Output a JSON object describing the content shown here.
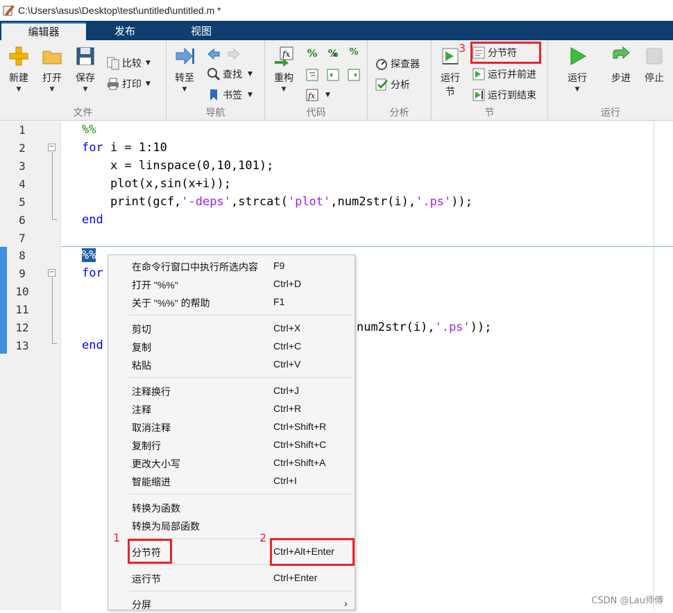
{
  "window": {
    "title": "C:\\Users\\asus\\Desktop\\test\\untitled\\untitled.m *"
  },
  "tabs": [
    {
      "label": "编辑器"
    },
    {
      "label": "发布"
    },
    {
      "label": "视图"
    }
  ],
  "ribbon": {
    "file": {
      "label": "文件",
      "new": "新建",
      "open": "打开",
      "save": "保存",
      "compare": "比较",
      "print": "打印"
    },
    "nav": {
      "label": "导航",
      "goto": "转至",
      "find": "查找",
      "bookmark": "书签"
    },
    "code": {
      "label": "代码",
      "refactor": "重构"
    },
    "analyze": {
      "label": "分析",
      "explorer": "探查器",
      "analyze": "分析"
    },
    "section": {
      "label": "节",
      "run_section_l1": "运行",
      "run_section_l2": "节",
      "section_break": "分节符",
      "run_advance": "运行并前进",
      "run_to_end": "运行到结束"
    },
    "run": {
      "label": "运行",
      "run": "运行",
      "step": "步进",
      "stop": "停止"
    }
  },
  "annotations": {
    "n1": "1",
    "n2": "2",
    "n3": "3"
  },
  "editor": {
    "line_numbers": [
      "1",
      "2",
      "3",
      "4",
      "5",
      "6",
      "7",
      "8",
      "9",
      "10",
      "11",
      "12",
      "13"
    ],
    "code": {
      "l1": "%%",
      "l2_kw": "for",
      "l2": " i = 1:10",
      "l3": "    x = linspace(0,10,101);",
      "l4": "    plot(x,sin(x+i));",
      "l5_a": "    print(gcf,",
      "l5_s1": "'-deps'",
      "l5_b": ",strcat(",
      "l5_s2": "'plot'",
      "l5_c": ",num2str(i),",
      "l5_s3": "'.ps'",
      "l5_d": "));",
      "l6_kw": "end",
      "l8": "%%",
      "l9_kw": "for",
      "l12_c": "num2str(i),",
      "l12_s3": "'.ps'",
      "l12_d": "));",
      "l13_kw": "end"
    }
  },
  "context_menu": {
    "items": [
      {
        "label": "在命令行窗口中执行所选内容",
        "shortcut": "F9"
      },
      {
        "label": "打开 \"%%\"",
        "shortcut": "Ctrl+D"
      },
      {
        "label": "关于 \"%%\" 的帮助",
        "shortcut": "F1"
      },
      {
        "label": "剪切",
        "shortcut": "Ctrl+X"
      },
      {
        "label": "复制",
        "shortcut": "Ctrl+C"
      },
      {
        "label": "粘贴",
        "shortcut": "Ctrl+V"
      },
      {
        "label": "注释换行",
        "shortcut": "Ctrl+J"
      },
      {
        "label": "注释",
        "shortcut": "Ctrl+R"
      },
      {
        "label": "取消注释",
        "shortcut": "Ctrl+Shift+R"
      },
      {
        "label": "复制行",
        "shortcut": "Ctrl+Shift+C"
      },
      {
        "label": "更改大小写",
        "shortcut": "Ctrl+Shift+A"
      },
      {
        "label": "智能缩进",
        "shortcut": "Ctrl+I"
      },
      {
        "label": "转换为函数",
        "shortcut": ""
      },
      {
        "label": "转换为局部函数",
        "shortcut": ""
      },
      {
        "label": "分节符",
        "shortcut": "Ctrl+Alt+Enter"
      },
      {
        "label": "运行节",
        "shortcut": "Ctrl+Enter"
      },
      {
        "label": "分屏",
        "shortcut": "›"
      }
    ]
  },
  "watermark": "CSDN @Lau师傅"
}
